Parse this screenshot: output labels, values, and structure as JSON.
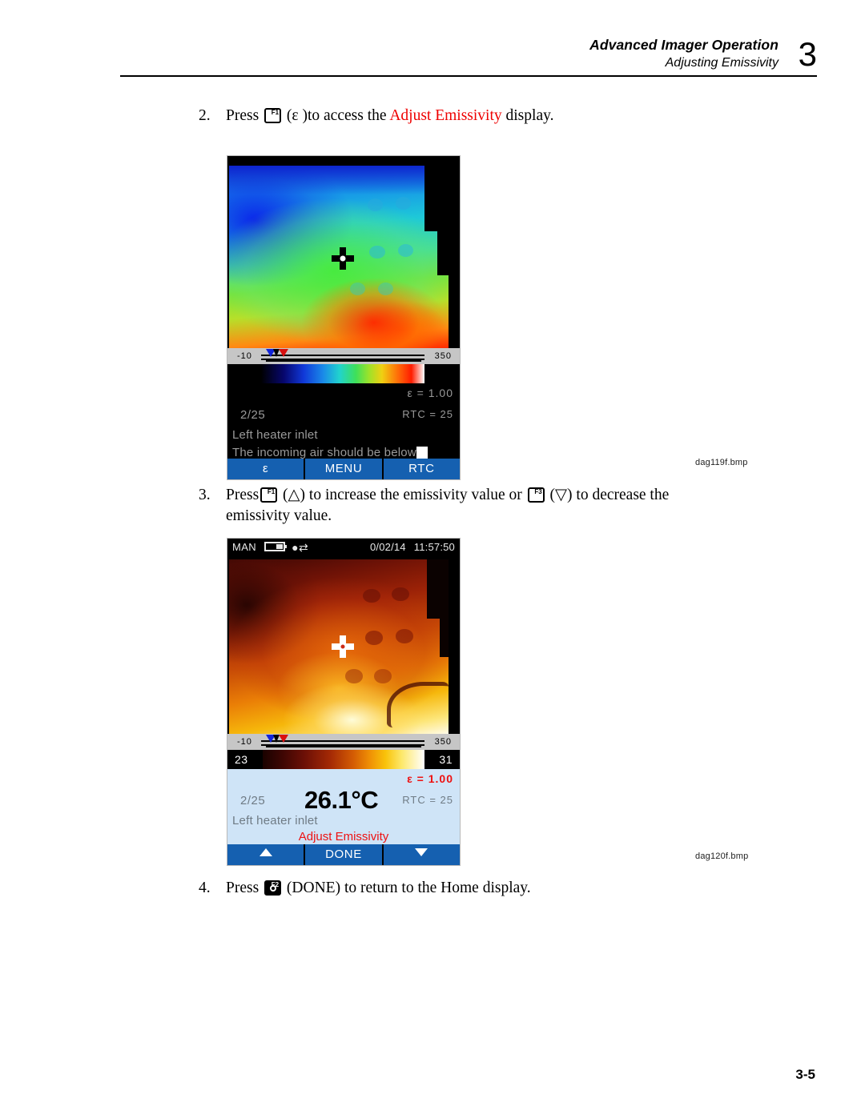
{
  "header": {
    "title": "Advanced Imager Operation",
    "subtitle": "Adjusting Emissivity",
    "chapter": "3"
  },
  "steps": [
    {
      "number": "2.",
      "pre": "Press",
      "key": "F1",
      "paren": "(ε )",
      "mid": "to access the ",
      "highlight": "Adjust Emissivity",
      "post": " display."
    },
    {
      "number": "3.",
      "pre": "Press",
      "key1": "F1",
      "paren1": "(△)",
      "mid1": " to increase the emissivity value or ",
      "key2": "F3",
      "paren2": "(▽)",
      "mid2": " to decrease the",
      "line2": "emissivity value."
    },
    {
      "number": "4.",
      "pre": "Press",
      "key": "F2",
      "post": "(DONE) to return to the Home display."
    }
  ],
  "screen1": {
    "range": {
      "low": "-10",
      "high": "350"
    },
    "info": {
      "emissivity": "ε =  1.00",
      "frame": "2/25",
      "rtc": "RTC =   25",
      "label1": "Left heater inlet",
      "label2": "The incoming air should be below"
    },
    "softkeys": [
      "ε",
      "MENU",
      "RTC"
    ],
    "caption": "dag119f.bmp"
  },
  "screen2": {
    "statusbar": {
      "mode": "MAN",
      "date": "0/02/14",
      "time": "11:57:50"
    },
    "range": {
      "low": "-10",
      "high": "350"
    },
    "palette": {
      "min": "23",
      "max": "31"
    },
    "info": {
      "emissivity": "ε =  1.00",
      "frame": "2/25",
      "temperature": "26.1°C",
      "rtc": "RTC =   25",
      "label1": "Left heater inlet",
      "mode_label": "Adjust Emissivity"
    },
    "softkeys": [
      "▲",
      "DONE",
      "▼"
    ],
    "caption": "dag120f.bmp"
  },
  "footer": {
    "page": "3-5"
  },
  "colors": {
    "highlight_red": "#ee0000",
    "softkey_blue": "#1560b0",
    "info_panel_light": "#cfe4f7",
    "marker_blue": "#1324d8",
    "marker_red": "#d81010"
  }
}
